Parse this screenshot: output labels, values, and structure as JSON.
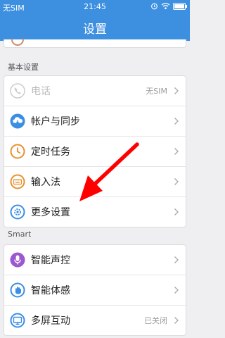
{
  "status_bar": {
    "carrier": "无SIM",
    "time": "21:45",
    "icons": [
      "alarm-icon",
      "wifi-icon",
      "battery-icon"
    ]
  },
  "header": {
    "title": "设置"
  },
  "sections": [
    {
      "title": "基本设置",
      "items": [
        {
          "label": "电话",
          "value": "无SIM",
          "icon": "phone-icon",
          "disabled": true
        },
        {
          "label": "帐户与同步",
          "value": "",
          "icon": "cloud-sync-icon"
        },
        {
          "label": "定时任务",
          "value": "",
          "icon": "clock-icon"
        },
        {
          "label": "输入法",
          "value": "",
          "icon": "keyboard-icon"
        },
        {
          "label": "更多设置",
          "value": "",
          "icon": "gear-icon"
        }
      ]
    },
    {
      "title": "Smart",
      "items": [
        {
          "label": "智能声控",
          "value": "",
          "icon": "microphone-icon"
        },
        {
          "label": "智能体感",
          "value": "",
          "icon": "hand-motion-icon"
        },
        {
          "label": "多屏互动",
          "value": "已关闭",
          "icon": "screen-share-icon"
        }
      ]
    }
  ],
  "colors": {
    "primary": "#3d8fe0",
    "arrow": "#ff0000",
    "background": "#efeff2"
  }
}
